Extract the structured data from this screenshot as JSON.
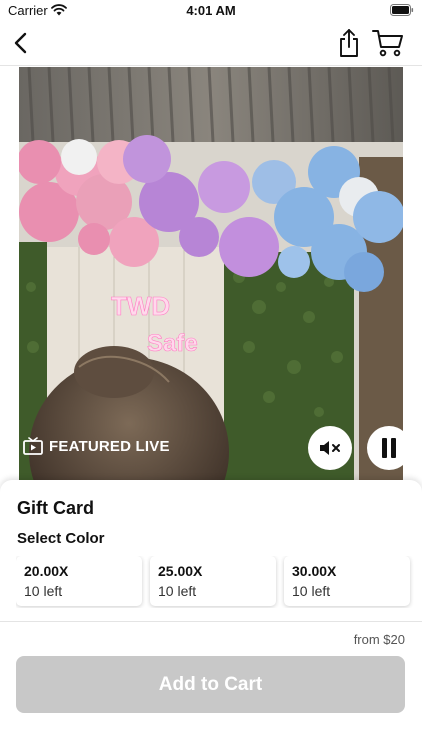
{
  "status_bar": {
    "carrier": "Carrier",
    "time": "4:01 AM"
  },
  "nav": {
    "back_icon": "chevron-left-icon",
    "share_icon": "share-icon",
    "cart_icon": "cart-icon"
  },
  "video": {
    "badge_label": "FEATURED LIVE",
    "sign_text_line1": "TWD",
    "sign_text_line2": "Safe",
    "mute_icon": "speaker-muted-icon",
    "pause_icon": "pause-icon",
    "colors": {
      "pink": "#e98fb0",
      "purple": "#b785d6",
      "blue": "#87b3e3",
      "hedge": "#3f5b2a"
    }
  },
  "product": {
    "title": "Gift Card",
    "select_label": "Select Color",
    "variants": [
      {
        "name": "20.00X",
        "stock": "10 left"
      },
      {
        "name": "25.00X",
        "stock": "10 left"
      },
      {
        "name": "30.00X",
        "stock": "10 left"
      }
    ],
    "price": "from $20",
    "add_to_cart_label": "Add to Cart",
    "button_disabled_color": "#c8c8c8"
  }
}
